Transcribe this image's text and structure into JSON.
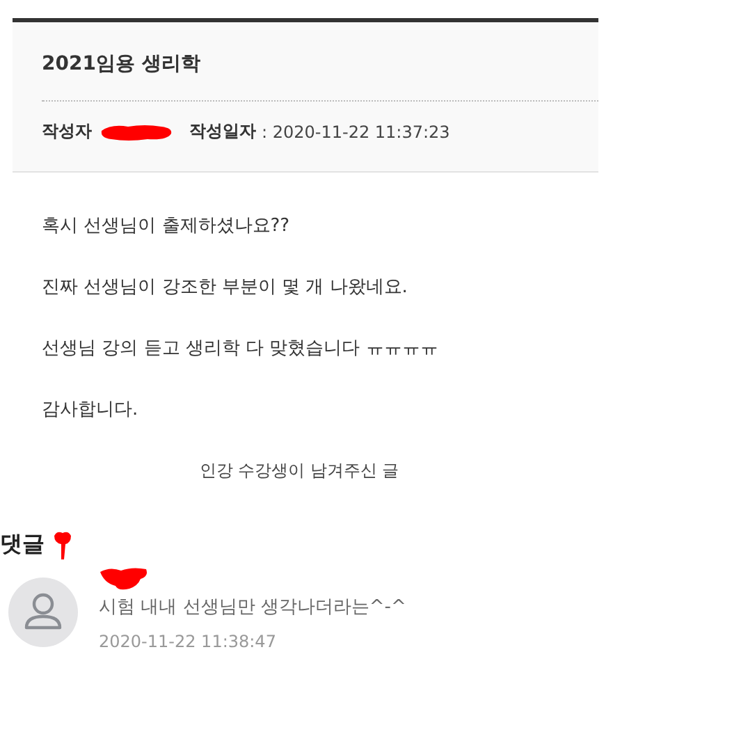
{
  "post": {
    "title": "2021임용 생리학",
    "author_label": "작성자",
    "date_label": "작성일자",
    "date_value": ": 2020-11-22 11:37:23"
  },
  "body": [
    "혹시 선생님이 출제하셨나요??",
    "진짜 선생님이 강조한 부분이 몇 개 나왔네요.",
    "선생님 강의 듣고 생리학 다 맞혔습니다 ㅠㅠㅠㅠ",
    "감사합니다."
  ],
  "caption": "인강 수강생이 남겨주신 글",
  "comments_heading": "댓글",
  "comments": [
    {
      "text": "시험 내내 선생님만 생각나더라는^-^",
      "date": "2020-11-22 11:38:47"
    }
  ]
}
